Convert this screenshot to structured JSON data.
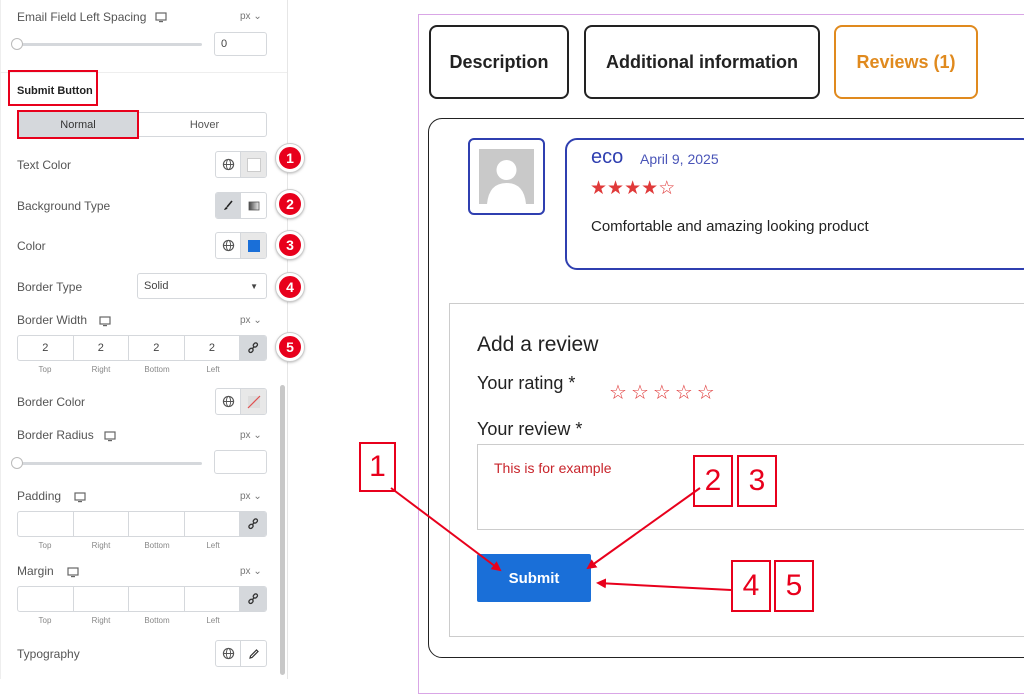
{
  "panel": {
    "email_spacing_label": "Email Field Left Spacing",
    "email_spacing_unit": "px",
    "email_spacing_value": "0",
    "submit_button_label": "Submit Button",
    "tab_normal": "Normal",
    "tab_hover": "Hover",
    "text_color_label": "Text Color",
    "background_type_label": "Background Type",
    "color_label": "Color",
    "border_type_label": "Border Type",
    "border_type_value": "Solid",
    "border_width_label": "Border Width",
    "border_width_unit": "px",
    "border_width_values": [
      "2",
      "2",
      "2",
      "2"
    ],
    "side_labels": [
      "Top",
      "Right",
      "Bottom",
      "Left"
    ],
    "border_color_label": "Border Color",
    "border_radius_label": "Border Radius",
    "border_radius_unit": "px",
    "padding_label": "Padding",
    "padding_unit": "px",
    "margin_label": "Margin",
    "margin_unit": "px",
    "typography_label": "Typography",
    "accent_color": "#1a6fd8"
  },
  "badges": [
    "1",
    "2",
    "3",
    "4",
    "5"
  ],
  "annotations": {
    "label_1": "1",
    "label_2": "2",
    "label_3": "3",
    "label_4": "4",
    "label_5": "5",
    "color": "#e8001c"
  },
  "preview": {
    "tabs": [
      "Description",
      "Additional information",
      "Reviews (1)"
    ],
    "active_tab_color": "#e08a1e",
    "review": {
      "author": "eco",
      "date": "April 9, 2025",
      "rating": 4,
      "max_rating": 5,
      "text": "Comfortable and amazing looking product"
    },
    "add_review_title": "Add a review",
    "your_rating_label": "Your rating *",
    "your_review_label": "Your review *",
    "review_text": "This is for example",
    "submit_label": "Submit",
    "submit_color": "#1a6fd8"
  }
}
